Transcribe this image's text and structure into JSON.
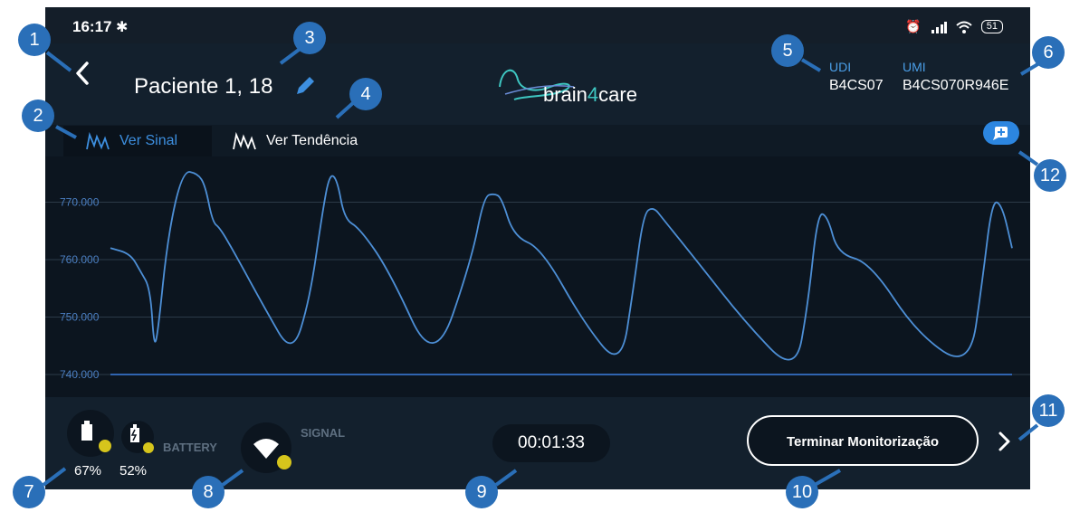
{
  "status_bar": {
    "time": "16:17",
    "battery": "51",
    "icons": [
      "bluetooth-icon",
      "alarm-icon",
      "signal-bars-icon",
      "wifi-icon",
      "battery-icon"
    ]
  },
  "header": {
    "patient": "Paciente 1, 18",
    "logo_text_a": "brain",
    "logo_text_b": "4",
    "logo_text_c": "care",
    "udi_label": "UDI",
    "udi_value": "B4CS07",
    "umi_label": "UMI",
    "umi_value": "B4CS070R946E"
  },
  "tabs": [
    {
      "label": "Ver Sinal",
      "active": true
    },
    {
      "label": "Ver Tendência",
      "active": false
    }
  ],
  "chart_data": {
    "type": "line",
    "yticks": [
      "770.000",
      "760.000",
      "750.000",
      "740.000"
    ],
    "ylim": [
      737,
      777
    ],
    "series": [
      {
        "color": "#4d8fd6",
        "x": [
          0,
          0.8,
          1.2,
          1.6,
          1.75,
          1.9,
          2.3,
          2.9,
          3.5,
          3.8,
          4.1,
          4.4,
          5.0,
          6.2,
          7.3,
          8.0,
          8.5,
          8.8,
          9.1,
          9.4,
          10.0,
          11.2,
          13.0,
          14.5,
          15.0,
          15.4,
          15.7,
          16.2,
          17.3,
          19.0,
          20.5,
          21.0,
          21.4,
          21.8,
          22.2,
          23.5,
          25.5,
          27.5,
          28.0,
          28.4,
          28.8,
          29.2,
          30.5,
          32.4,
          34.5,
          35.0,
          35.4,
          35.8,
          36.2
        ],
        "y": [
          762,
          761,
          758,
          755,
          744.8,
          747,
          764,
          775.5,
          775,
          773,
          766.5,
          765.5,
          761,
          751.5,
          743.2,
          753,
          768,
          775,
          774,
          767,
          765.5,
          758,
          741,
          760,
          771,
          771.5,
          770.8,
          764,
          762,
          749,
          741,
          755,
          768,
          769.2,
          767,
          760,
          749,
          740,
          752,
          768.3,
          767.5,
          761,
          759.5,
          747,
          741,
          756,
          770.4,
          769.5,
          762
        ]
      }
    ],
    "baseline": 740
  },
  "bottom": {
    "battery_label": "BATTERY",
    "battery1": "67%",
    "battery2": "52%",
    "signal_label": "SIGNAL",
    "timer": "00:01:33",
    "end_button": "Terminar Monitorização"
  },
  "markers": [
    "1",
    "2",
    "3",
    "4",
    "5",
    "6",
    "7",
    "8",
    "9",
    "10",
    "11",
    "12"
  ],
  "colors": {
    "accent": "#2c86e0",
    "marker": "#2a6fb8",
    "background": "#0f1a25",
    "indicator": "#d6c51c"
  }
}
